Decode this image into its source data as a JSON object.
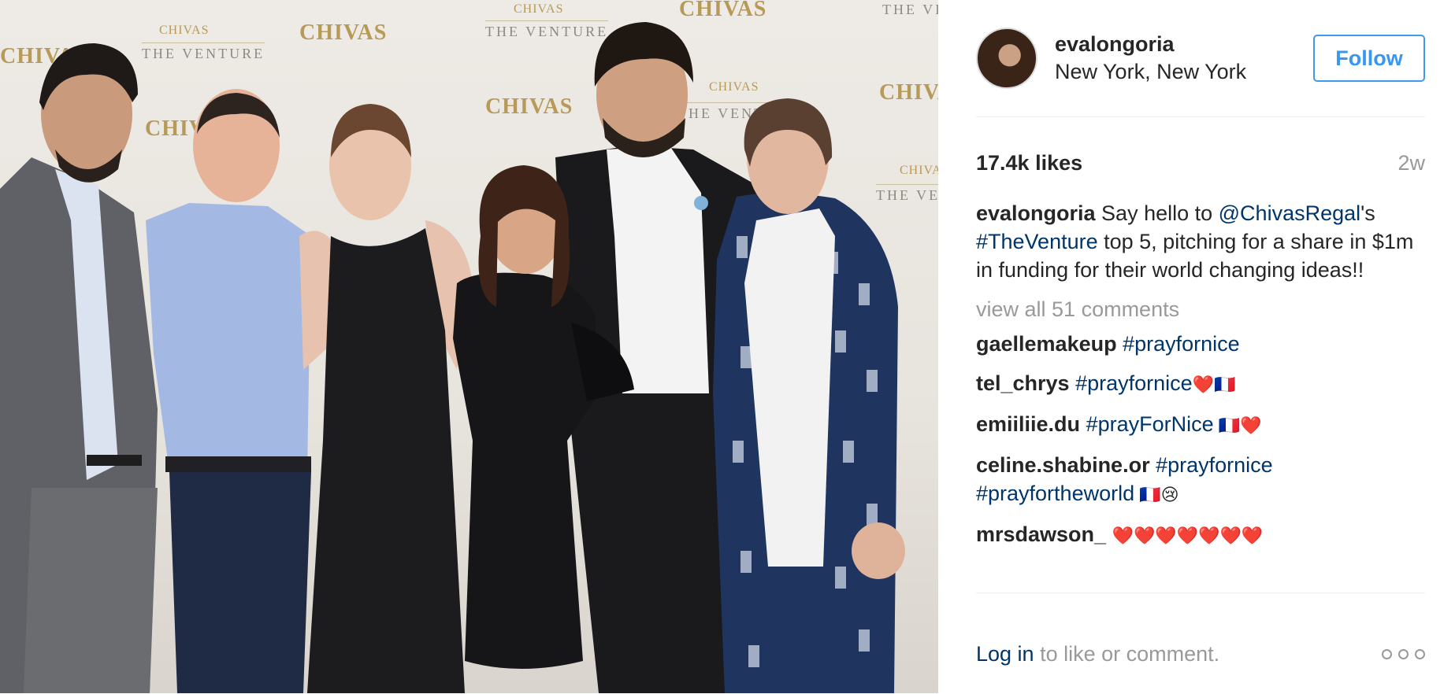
{
  "photo": {
    "alt_brand": "CHIVAS",
    "alt_brand_small": "CHIVAS",
    "venture": "THE VENTURE"
  },
  "header": {
    "username": "evalongoria",
    "location": "New York, New York",
    "follow_label": "Follow"
  },
  "stats": {
    "likes": "17.4k likes",
    "time_ago": "2w"
  },
  "caption": {
    "username": "evalongoria",
    "text_1": " Say hello to ",
    "mention": "@ChivasRegal",
    "text_2": "'s ",
    "hashtag": "#TheVenture",
    "text_3": " top 5, pitching for a share in $1m in funding for their world changing ideas!!"
  },
  "view_all_comments": "view all 51 comments",
  "comments": [
    {
      "username": "gaellemakeup",
      "tags": "#prayfornice",
      "emoji": ""
    },
    {
      "username": "tel_chrys",
      "tags": "#prayfornice",
      "emoji": "❤️🇫🇷"
    },
    {
      "username": "emiiliie.du",
      "tags": "#prayForNice",
      "emoji": " 🇫🇷❤️"
    },
    {
      "username": "celine.shabine.or",
      "tags": "#prayfornice #prayfortheworld",
      "emoji": " 🇫🇷😢"
    },
    {
      "username": "mrsdawson_",
      "tags": "",
      "emoji": "❤️❤️❤️❤️❤️❤️❤️"
    }
  ],
  "footer": {
    "login_label": "Log in",
    "rest": " to like or comment.",
    "more_icon": "more-options-icon"
  },
  "colors": {
    "link": "#003569",
    "follow": "#3897f0",
    "muted": "#999999",
    "text": "#262626"
  }
}
